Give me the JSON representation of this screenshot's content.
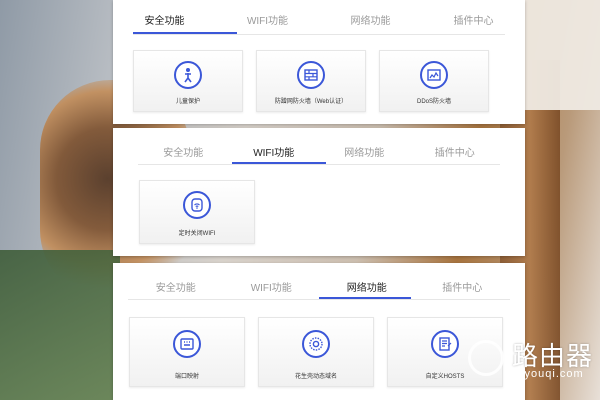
{
  "colors": {
    "accent": "#3b57d8",
    "panel": "#ffffff",
    "inactive_tab": "#9a9a9a"
  },
  "tabs": [
    "安全功能",
    "WIFI功能",
    "网络功能",
    "插件中心"
  ],
  "panels": [
    {
      "active_tab": 0,
      "cards": [
        {
          "label": "儿童保护",
          "icon": "child-protection-icon"
        },
        {
          "label": "防蹭网防火墙（Web认证）",
          "icon": "firewall-icon"
        },
        {
          "label": "DDoS防火墙",
          "icon": "ddos-firewall-icon"
        }
      ]
    },
    {
      "active_tab": 1,
      "cards": [
        {
          "label": "定时关闭WIFI",
          "icon": "timer-wifi-icon"
        }
      ]
    },
    {
      "active_tab": 2,
      "cards": [
        {
          "label": "端口映射",
          "icon": "port-mapping-icon"
        },
        {
          "label": "花生壳动态域名",
          "icon": "ddns-icon"
        },
        {
          "label": "自定义HOSTS",
          "icon": "hosts-icon"
        }
      ]
    }
  ],
  "watermark": {
    "title": "路由器",
    "site": "luyouqi.com"
  }
}
